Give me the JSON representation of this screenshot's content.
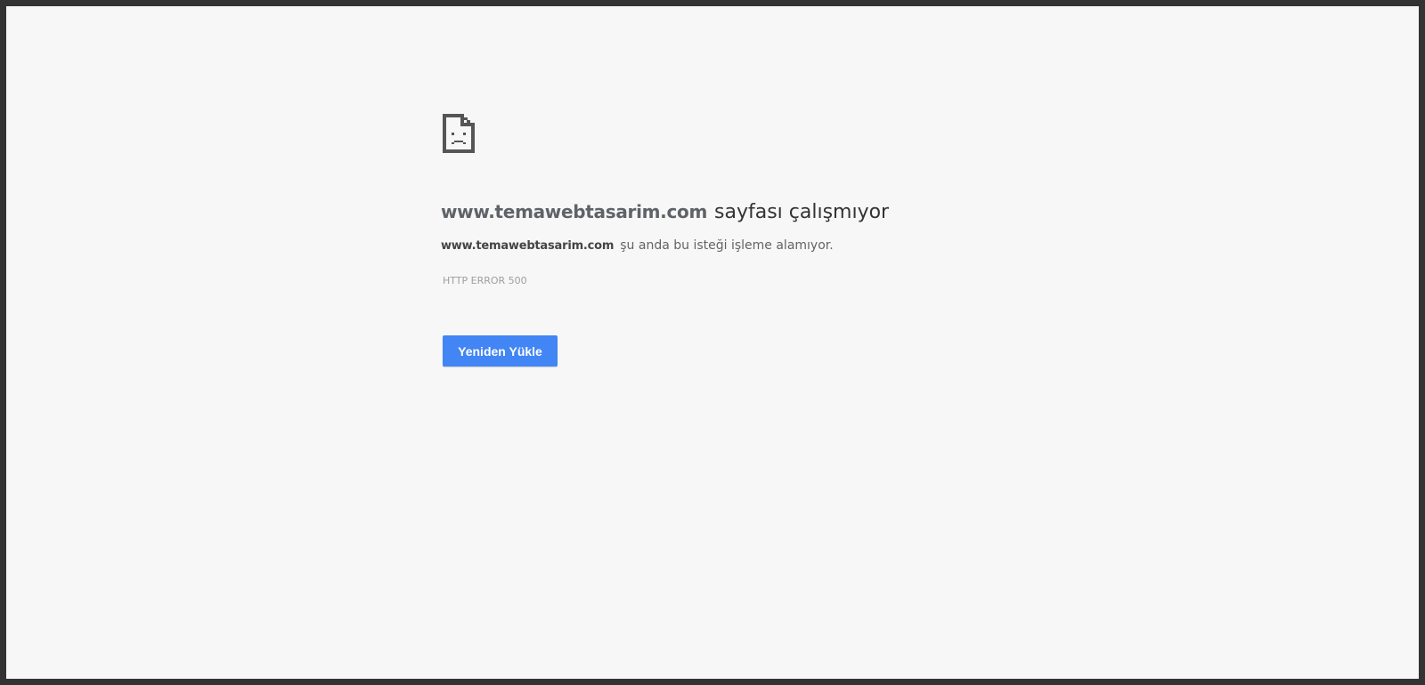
{
  "error_page": {
    "icon": "sad-page-icon",
    "heading": {
      "host": "www.temawebtasarim.com",
      "text": "sayfası çalışmıyor"
    },
    "message": {
      "host": "www.temawebtasarim.com",
      "text": "şu anda bu isteği işleme alamıyor."
    },
    "error_code": "HTTP ERROR 500",
    "reload_button_label": "Yeniden Yükle"
  },
  "colors": {
    "background": "#f7f7f7",
    "frame": "#333333",
    "button": "#4285f4",
    "icon": "#555555"
  }
}
